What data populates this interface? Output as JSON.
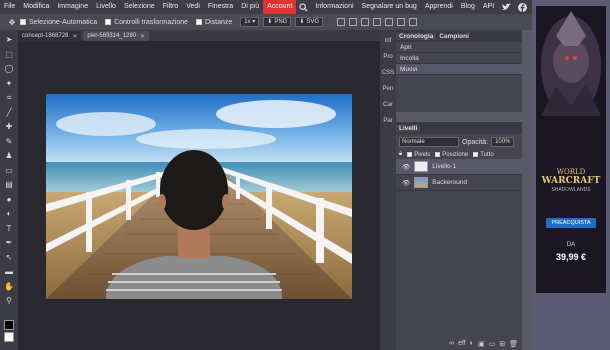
{
  "menu": {
    "items": [
      "File",
      "Modifica",
      "Immagine",
      "Livello",
      "Selezione",
      "Filtro",
      "Vedi",
      "Finestra",
      "Di più",
      "Account"
    ],
    "right_items": [
      "Informazioni",
      "Segnalare un bug",
      "Apprendi",
      "Blog",
      "API"
    ]
  },
  "options": {
    "auto_select": "Selezione-Automatica",
    "transform_controls": "Controlli trasformazione",
    "distances": "Distanze",
    "zoom": "1x",
    "png_label": "PNG",
    "svg_label": "SVG"
  },
  "tabs": [
    {
      "label": "concept-1868728"
    },
    {
      "label": "pier-569314_1280"
    }
  ],
  "minicol": [
    "Inf",
    "Pro",
    "CSS",
    "Pen",
    "Car",
    "Par"
  ],
  "history": {
    "tabs": [
      "Cronologia",
      "Campioni"
    ],
    "items": [
      "Apri",
      "Incolla",
      "Muovi"
    ]
  },
  "layers": {
    "title": "Livelli",
    "blend_mode": "Normale",
    "opacity_label": "Opacità:",
    "opacity_value": "100%",
    "lock_labels": [
      "Pixels",
      "Posizione",
      "Tutto"
    ],
    "items": [
      "Livello 1",
      "Backeround"
    ]
  },
  "ad": {
    "line1": "WORLD",
    "line2": "WARCRAFT",
    "line3": "SHADOWLANDS",
    "button": "PREACQUISTA",
    "price_prefix": "DA",
    "price": "39,99 €"
  },
  "colors": {
    "menubar": "#3d3d47",
    "account": "#e0322f",
    "canvas": "#28282e",
    "panel": "#45454f"
  }
}
